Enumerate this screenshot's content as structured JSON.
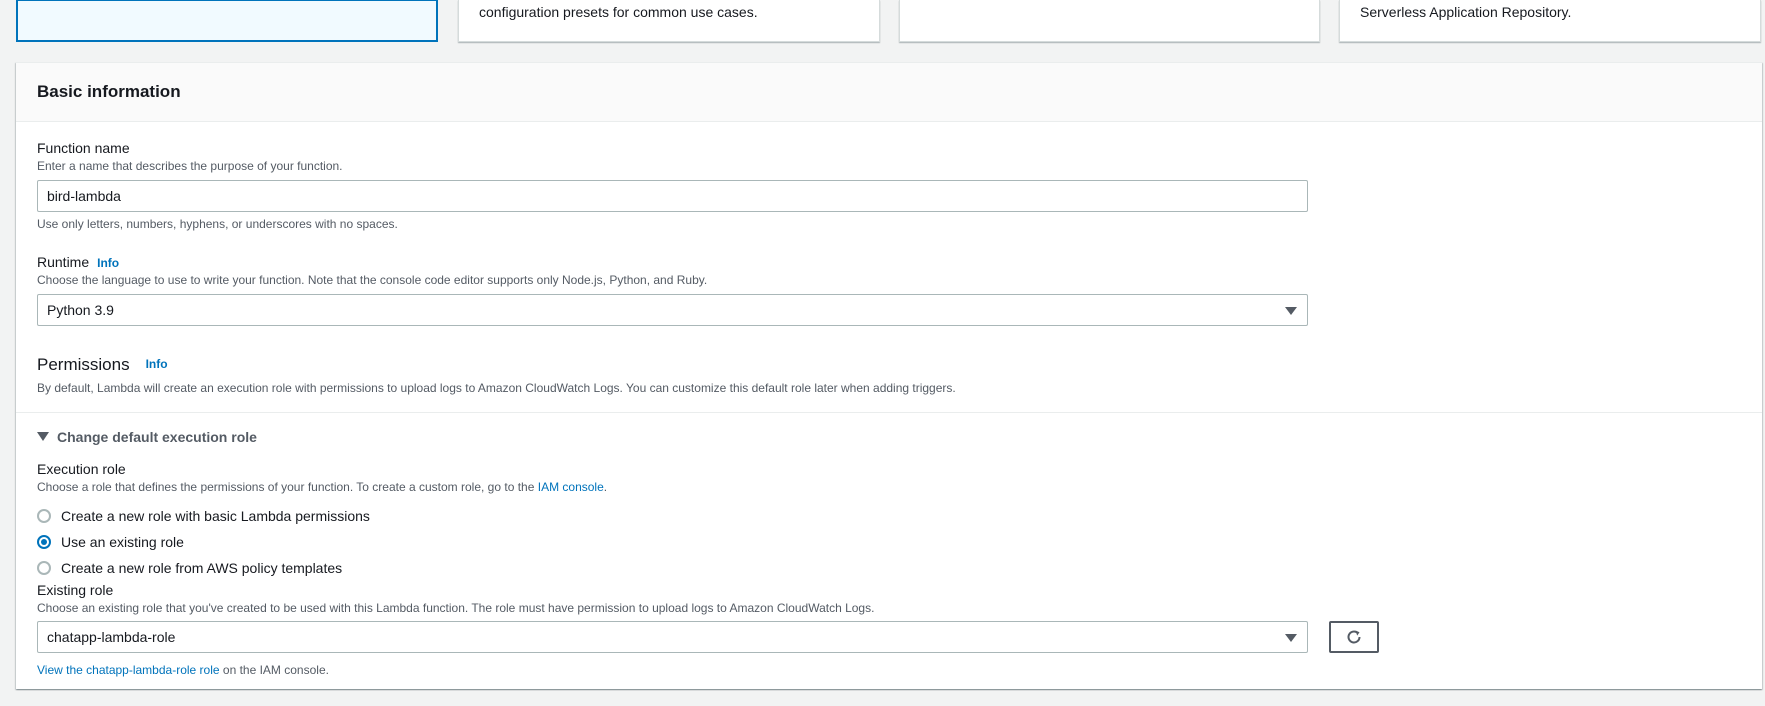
{
  "top_cards": [
    {
      "text": ""
    },
    {
      "text": "configuration presets for common use cases."
    },
    {
      "text": ""
    },
    {
      "text": "Serverless Application Repository."
    }
  ],
  "basic_info": {
    "title": "Basic information",
    "function_name": {
      "label": "Function name",
      "description": "Enter a name that describes the purpose of your function.",
      "value": "bird-lambda",
      "constraint": "Use only letters, numbers, hyphens, or underscores with no spaces."
    },
    "runtime": {
      "label": "Runtime",
      "info": "Info",
      "description": "Choose the language to use to write your function. Note that the console code editor supports only Node.js, Python, and Ruby.",
      "value": "Python 3.9"
    },
    "permissions": {
      "label": "Permissions",
      "info": "Info",
      "description": "By default, Lambda will create an execution role with permissions to upload logs to Amazon CloudWatch Logs. You can customize this default role later when adding triggers."
    },
    "change_role": {
      "label": "Change default execution role"
    },
    "execution_role": {
      "label": "Execution role",
      "description_prefix": "Choose a role that defines the permissions of your function. To create a custom role, go to the",
      "description_link": "IAM console",
      "description_suffix": ".",
      "options": [
        {
          "label": "Create a new role with basic Lambda permissions",
          "selected": false
        },
        {
          "label": "Use an existing role",
          "selected": true
        },
        {
          "label": "Create a new role from AWS policy templates",
          "selected": false
        }
      ]
    },
    "existing_role": {
      "label": "Existing role",
      "description": "Choose an existing role that you've created to be used with this Lambda function. The role must have permission to upload logs to Amazon CloudWatch Logs.",
      "value": "chatapp-lambda-role",
      "view_link": "View the chatapp-lambda-role role",
      "view_suffix": " on the IAM console."
    }
  },
  "colors": {
    "accent": "#0073bb",
    "text": "#16191f",
    "muted": "#545b64",
    "border": "#aab7b8"
  }
}
